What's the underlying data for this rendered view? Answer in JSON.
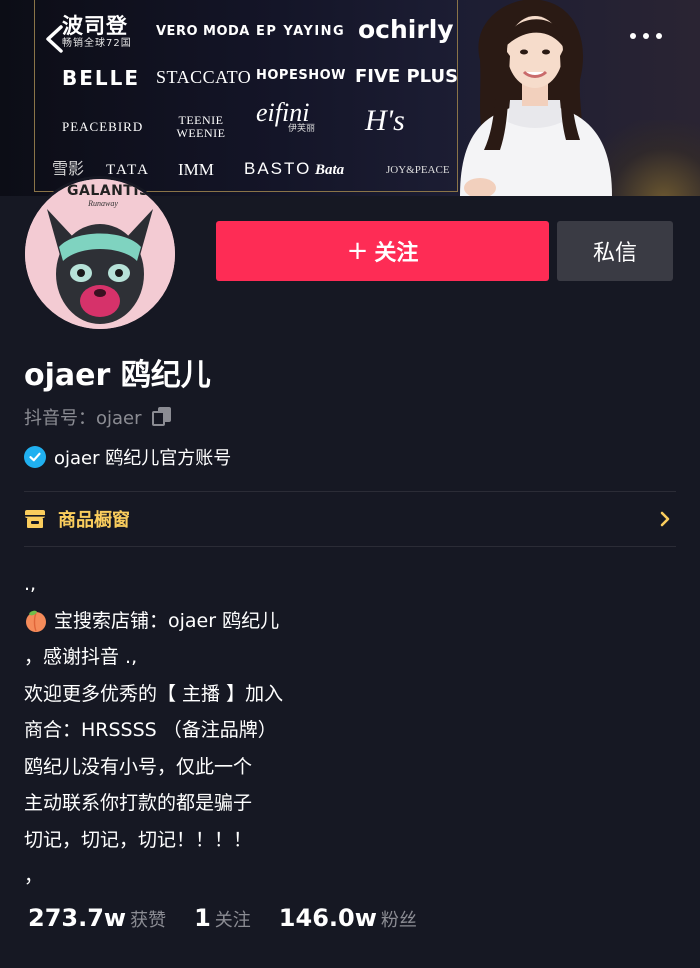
{
  "banner": {
    "brands": {
      "bosideng": "波司登",
      "bosideng_sub": "畅销全球72国",
      "vero_moda": "VERO MODA",
      "ep_yaying": "EP YAYING",
      "ochirly": "ochirly",
      "belle": "BELLE",
      "staccato": "STACCATO",
      "hopeshow": "HOPESHOW",
      "five_plus": "FIVE PLUS",
      "peacebird": "PEACEBIRD",
      "teenie_weenie": "TEENIE WEENIE",
      "eifini": "eifini",
      "eifini_sub": "伊芙丽",
      "hs": "H's",
      "xueying": "雪影",
      "tata": "TATA",
      "imm": "IMM",
      "basto": "BASTO",
      "bata": "Bata",
      "joy_peace": "JOY&PEACE"
    }
  },
  "avatar": {
    "text": "GALANTIS",
    "sub": "Runaway"
  },
  "actions": {
    "follow_plus": "+",
    "follow_label": "关注",
    "message_label": "私信"
  },
  "profile": {
    "nickname": "ojaer 鸥纪儿",
    "douyin_id": "抖音号：ojaer",
    "verified_label": "ojaer 鸥纪儿官方账号"
  },
  "shop": {
    "label": "商品橱窗"
  },
  "bio": {
    "lines": [
      ".,",
      "宝搜索店铺：ojaer 鸥纪儿",
      "，感谢抖音 .,",
      "欢迎更多优秀的【 主播 】加入",
      "商合：HRSSSS （备注品牌）",
      "鸥纪儿没有小号，仅此一个",
      "主动联系你打款的都是骗子",
      "切记，切记，切记！！！！",
      "，"
    ]
  },
  "stats": {
    "likes_num": "273.7w",
    "likes_label": "获赞",
    "following_num": "1",
    "following_label": "关注",
    "followers_num": "146.0w",
    "followers_label": "粉丝"
  },
  "colors": {
    "background": "#161823",
    "follow_button": "#fe2c55",
    "message_button": "#3a3b44",
    "shop_accent": "#facd5d",
    "verified_badge": "#20b0f0",
    "secondary_text": "#8b8c93"
  },
  "icons": {
    "back": "chevron-left-icon",
    "more": "more-dots-icon",
    "copy": "copy-icon",
    "verified": "verified-check-icon",
    "shop": "shop-icon",
    "chevron": "chevron-right-icon",
    "peach": "peach-emoji-icon"
  }
}
